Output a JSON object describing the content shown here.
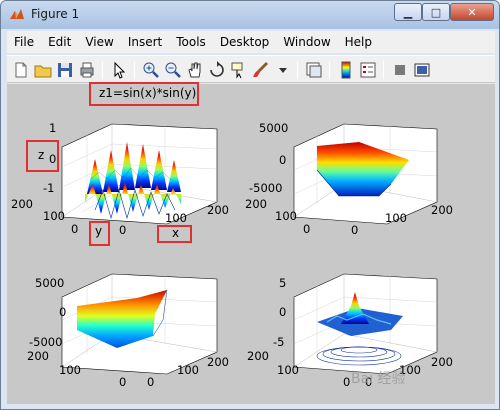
{
  "window": {
    "title": "Figure 1",
    "controls": {
      "minimize": "▁",
      "maximize": "□",
      "close": "✕"
    }
  },
  "menu": [
    "File",
    "Edit",
    "View",
    "Insert",
    "Tools",
    "Desktop",
    "Window",
    "Help"
  ],
  "toolbar": {
    "icons": [
      "new-figure-icon",
      "open-file-icon",
      "save-icon",
      "print-icon",
      "edit-plot-icon",
      "zoom-in-icon",
      "zoom-out-icon",
      "pan-icon",
      "rotate-3d-icon",
      "data-cursor-icon",
      "brush-icon",
      "link-plot-icon",
      "colorbar-icon",
      "legend-icon",
      "hide-plot-tools-icon",
      "show-plot-tools-icon"
    ]
  },
  "annotations": {
    "title": "z1=sin(x)*sin(y)",
    "z_label": "z",
    "y_label": "y",
    "x_label": "x"
  },
  "subplots": [
    {
      "id": "top-left",
      "z_ticks": [
        "1",
        "0",
        "-1"
      ],
      "y_ticks": [
        "200",
        "100",
        "0"
      ],
      "x_ticks": [
        "0",
        "100",
        "200"
      ],
      "surface": "z1=sin(x)*sin(y)"
    },
    {
      "id": "top-right",
      "z_ticks": [
        "5000",
        "0",
        "-5000"
      ],
      "y_ticks": [
        "200",
        "100",
        "0"
      ],
      "x_ticks": [
        "0",
        "100",
        "200"
      ]
    },
    {
      "id": "bottom-left",
      "z_ticks": [
        "5000",
        "0",
        "-5000"
      ],
      "y_ticks": [
        "200",
        "100",
        "0"
      ],
      "x_ticks": [
        "0",
        "100",
        "200"
      ]
    },
    {
      "id": "bottom-right",
      "z_ticks": [
        "5",
        "0",
        "-5"
      ],
      "y_ticks": [
        "200",
        "100",
        "0"
      ],
      "x_ticks": [
        "0",
        "100",
        "200"
      ]
    }
  ],
  "watermark": "Bai 经验",
  "colors": {
    "highlight": "#e03030",
    "figure_bg": "#c8c8c8"
  }
}
